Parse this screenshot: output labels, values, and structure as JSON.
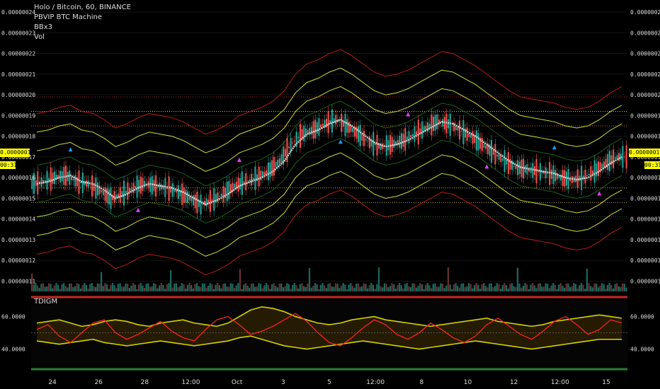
{
  "legend": {
    "title": "Holo / Bitcoin, 60, BINANCE",
    "line2": "PBVIP BTC Machine",
    "line3": "BBx3",
    "line4": "Vol"
  },
  "indicator": {
    "title": "TDIGM"
  },
  "last_price": "0.00000017",
  "countdown": "00:31",
  "colors": {
    "background": "#000000",
    "up_candle": "#26a69a",
    "down_candle": "#ef5350",
    "bb_outer": "#b71c1c",
    "bb_mid": "#cddc39",
    "bb_inner": "#1b5e20",
    "accent_yellow": "#ffff00",
    "signal_magenta": "#e040fb",
    "signal_blue": "#2196f3",
    "tdi_line": "#ff2222"
  },
  "chart_data": [
    {
      "type": "candlestick",
      "title": "Holo / Bitcoin, 60, BINANCE",
      "y_ticks": [
        "0.00000024",
        "0.00000023",
        "0.00000022",
        "0.00000021",
        "0.00000020",
        "0.00000019",
        "0.00000018",
        "0.00000017",
        "0.00000016",
        "0.00000015",
        "0.00000014",
        "0.00000013",
        "0.00000012",
        "0.00000011"
      ],
      "ylim": [
        1.05e-07,
        2.445e-07
      ],
      "x_ticks": [
        "24",
        "26",
        "28",
        "12:00",
        "Oct",
        "3",
        "5",
        "12:00",
        "8",
        "10",
        "12",
        "12:00",
        "15"
      ],
      "horizontal_levels": [
        1.99e-07,
        1.92e-07,
        1.85e-07,
        1.55e-07,
        1.48e-07,
        1.41e-07
      ],
      "close_series": [
        1.57e-07,
        1.58e-07,
        1.6e-07,
        1.61e-07,
        1.58e-07,
        1.57e-07,
        1.54e-07,
        1.5e-07,
        1.52e-07,
        1.55e-07,
        1.57e-07,
        1.56e-07,
        1.55e-07,
        1.53e-07,
        1.5e-07,
        1.47e-07,
        1.49e-07,
        1.52e-07,
        1.56e-07,
        1.58e-07,
        1.6e-07,
        1.63e-07,
        1.68e-07,
        1.76e-07,
        1.81e-07,
        1.83e-07,
        1.86e-07,
        1.88e-07,
        1.85e-07,
        1.81e-07,
        1.77e-07,
        1.75e-07,
        1.76e-07,
        1.78e-07,
        1.81e-07,
        1.84e-07,
        1.87e-07,
        1.86e-07,
        1.83e-07,
        1.8e-07,
        1.76e-07,
        1.72e-07,
        1.68e-07,
        1.65e-07,
        1.64e-07,
        1.63e-07,
        1.62e-07,
        1.6e-07,
        1.59e-07,
        1.6e-07,
        1.63e-07,
        1.67e-07,
        1.7e-07
      ]
    },
    {
      "type": "line",
      "title": "TDIGM",
      "y_ticks": [
        "60.0000",
        "40.0000"
      ],
      "ylim": [
        25,
        72
      ],
      "upper_band": [
        56,
        57,
        58,
        56,
        54,
        55,
        57,
        58,
        57,
        55,
        54,
        56,
        57,
        58,
        56,
        55,
        54,
        56,
        60,
        64,
        66,
        65,
        63,
        60,
        58,
        56,
        55,
        56,
        58,
        59,
        60,
        58,
        57,
        56,
        55,
        54,
        55,
        56,
        57,
        58,
        59,
        57,
        56,
        55,
        54,
        55,
        57,
        58,
        59,
        60,
        61,
        60,
        59
      ],
      "lower_band": [
        45,
        44,
        43,
        44,
        45,
        46,
        44,
        43,
        42,
        43,
        44,
        45,
        44,
        43,
        42,
        43,
        44,
        45,
        47,
        48,
        46,
        44,
        42,
        41,
        40,
        41,
        42,
        43,
        44,
        45,
        44,
        43,
        42,
        41,
        40,
        41,
        42,
        43,
        44,
        45,
        44,
        43,
        42,
        41,
        40,
        41,
        42,
        43,
        44,
        45,
        46,
        46,
        46
      ],
      "tdi_line": [
        52,
        55,
        48,
        44,
        50,
        56,
        58,
        50,
        46,
        49,
        53,
        57,
        51,
        47,
        45,
        52,
        58,
        60,
        55,
        49,
        51,
        54,
        58,
        62,
        57,
        50,
        44,
        42,
        47,
        53,
        58,
        55,
        49,
        46,
        50,
        56,
        52,
        47,
        44,
        48,
        55,
        59,
        54,
        49,
        46,
        51,
        57,
        60,
        55,
        49,
        52,
        58,
        56
      ]
    }
  ]
}
